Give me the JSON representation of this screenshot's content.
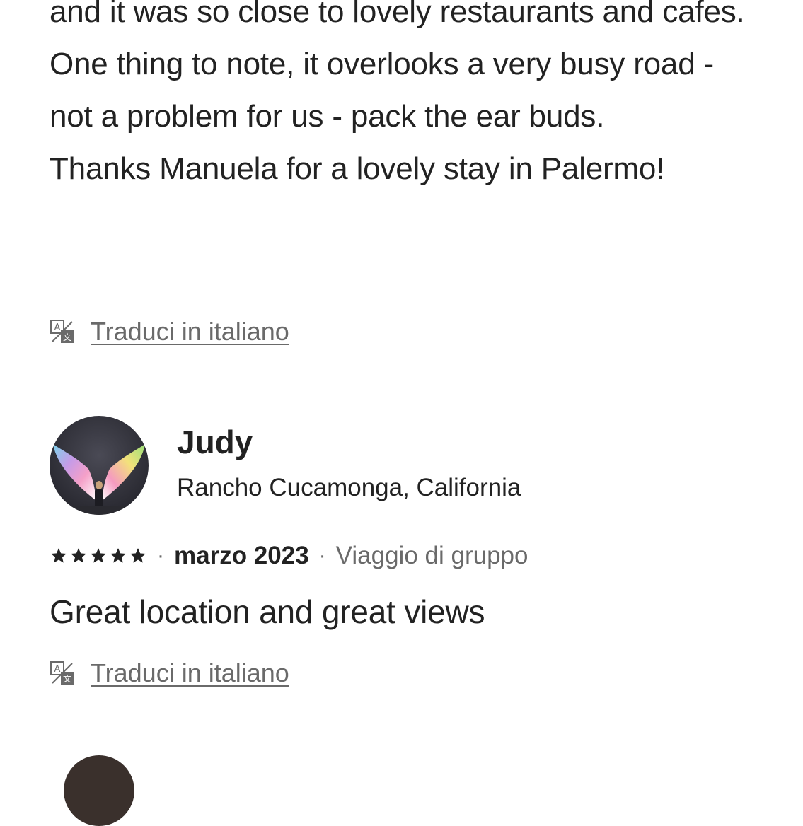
{
  "review1": {
    "body": "and it was so close to lovely restaurants and cafes.\nOne thing to note, it overlooks a very busy road - not a problem for us - pack the ear buds.\nThanks Manuela for a lovely stay in Palermo!",
    "translate_label": "Traduci in italiano",
    "translate_icon": "translate-icon"
  },
  "review2": {
    "name": "Judy",
    "location": "Rancho Cucamonga, California",
    "rating": 5,
    "rating_max": 5,
    "separator": "·",
    "date": "marzo 2023",
    "trip_type": "Viaggio di gruppo",
    "body": "Great location and great views",
    "translate_label": "Traduci in italiano",
    "translate_icon": "translate-icon",
    "avatar_icon": "avatar-photo"
  },
  "colors": {
    "text_primary": "#222222",
    "text_secondary": "#6a6a6a",
    "background": "#ffffff"
  }
}
